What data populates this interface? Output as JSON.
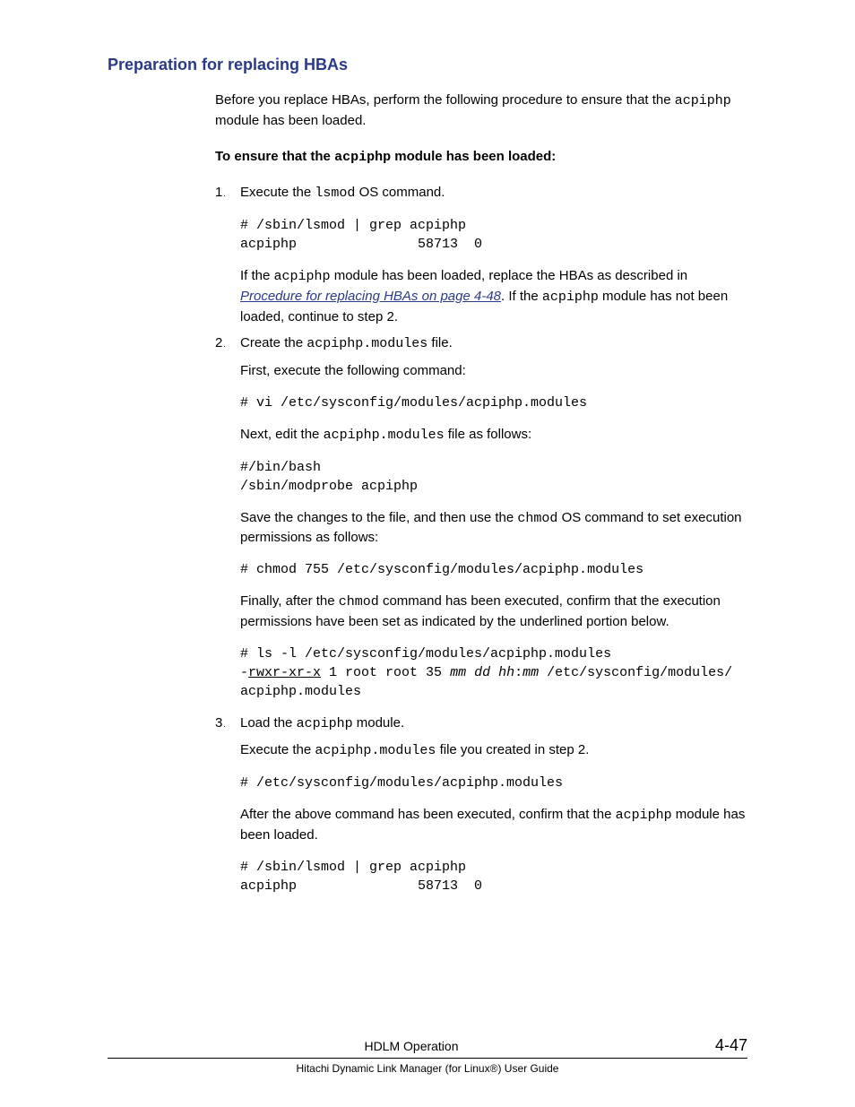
{
  "title": "Preparation for replacing HBAs",
  "intro_pre": "Before you replace HBAs, perform the following procedure to ensure that the ",
  "intro_mono": "acpiphp",
  "intro_post": " module has been loaded.",
  "sub_heading_pre": "To ensure that the ",
  "sub_heading_mono": "acpiphp",
  "sub_heading_post": " module has been loaded:",
  "steps": {
    "s1": {
      "num": "1",
      "line_pre": "Execute the ",
      "line_mono": "lsmod",
      "line_post": " OS command.",
      "code": "# /sbin/lsmod | grep acpiphp\nacpiphp               58713  0",
      "after_pre": "If the ",
      "after_mono1": "acpiphp",
      "after_mid1": " module has been loaded, replace the HBAs as described in ",
      "after_link": "Procedure for replacing HBAs on page 4-48",
      "after_mid2": ". If the ",
      "after_mono2": "acpiphp",
      "after_post": " module has not been loaded, continue to step 2."
    },
    "s2": {
      "num": "2",
      "line_pre": "Create the ",
      "line_mono": "acpiphp.modules",
      "line_post": " file.",
      "first_exec": "First, execute the following command:",
      "code1": "# vi /etc/sysconfig/modules/acpiphp.modules",
      "next_pre": "Next, edit the ",
      "next_mono": "acpiphp.modules",
      "next_post": " file as follows:",
      "code2": "#/bin/bash\n/sbin/modprobe acpiphp",
      "save_pre": "Save the changes to the file, and then use the ",
      "save_mono": "chmod",
      "save_post": " OS command to set execution permissions as follows:",
      "code3": "# chmod 755 /etc/sysconfig/modules/acpiphp.modules",
      "finally_pre": "Finally, after the ",
      "finally_mono": "chmod",
      "finally_post": " command has been executed, confirm that the execution permissions have been set as indicated by the underlined portion below.",
      "code4_line1": "# ls -l /etc/sysconfig/modules/acpiphp.modules",
      "code4_dash": "-",
      "code4_underlined": "rwxr-xr-x",
      "code4_mid": " 1 root root 35 ",
      "code4_italic1": "mm dd hh",
      "code4_colon": ":",
      "code4_italic2": "mm",
      "code4_rest": " /etc/sysconfig/modules/",
      "code4_line3": "acpiphp.modules"
    },
    "s3": {
      "num": "3",
      "line_pre": "Load the ",
      "line_mono": "acpiphp",
      "line_post": " module.",
      "exec_pre": "Execute the ",
      "exec_mono": "acpiphp.modules",
      "exec_post": " file you created in step 2.",
      "code1": "# /etc/sysconfig/modules/acpiphp.modules",
      "after_pre": "After the above command has been executed, confirm that the ",
      "after_mono": "acpiphp",
      "after_post": " module has been loaded.",
      "code2": "# /sbin/lsmod | grep acpiphp\nacpiphp               58713  0"
    }
  },
  "footer": {
    "center": "HDLM Operation",
    "pagenum": "4-47",
    "subtitle": "Hitachi Dynamic Link Manager (for Linux®) User Guide"
  }
}
